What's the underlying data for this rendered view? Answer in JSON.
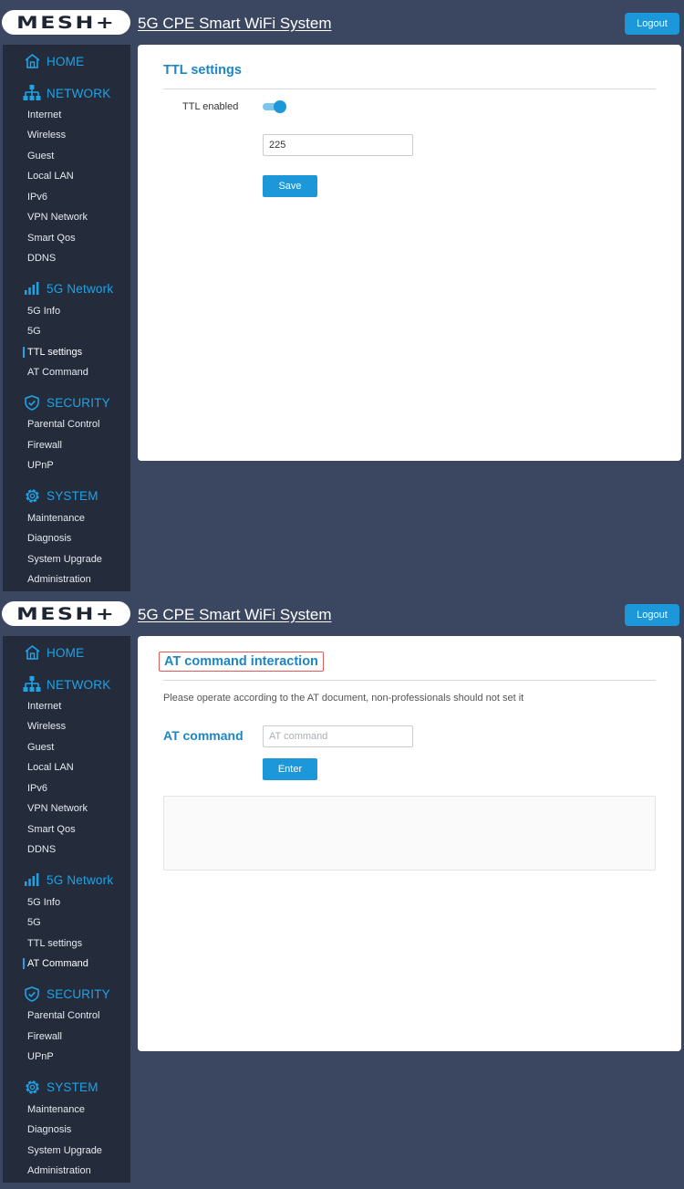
{
  "app": {
    "logo_text": "MESH+",
    "title": "5G CPE Smart WiFi System",
    "logout_label": "Logout"
  },
  "sidebar": {
    "home": {
      "label": "HOME",
      "icon": "home-icon"
    },
    "network": {
      "label": "NETWORK",
      "icon": "network-icon",
      "items": [
        "Internet",
        "Wireless",
        "Guest",
        "Local LAN",
        "IPv6",
        "VPN Network",
        "Smart Qos",
        "DDNS"
      ]
    },
    "fiveg": {
      "label": "5G Network",
      "icon": "signal-bars-icon",
      "items": [
        "5G Info",
        "5G",
        "TTL settings",
        "AT Command"
      ]
    },
    "security": {
      "label": "SECURITY",
      "icon": "shield-icon",
      "items": [
        "Parental Control",
        "Firewall",
        "UPnP"
      ]
    },
    "system": {
      "label": "SYSTEM",
      "icon": "gear-icon",
      "items": [
        "Maintenance",
        "Diagnosis",
        "System Upgrade",
        "Administration"
      ]
    }
  },
  "screens": [
    {
      "active_item": "TTL settings",
      "card_title": "TTL settings",
      "ttl_label": "TTL enabled",
      "ttl_enabled": true,
      "ttl_value": "225",
      "save_label": "Save"
    },
    {
      "active_item": "AT Command",
      "card_title": "AT command interaction",
      "note": "Please operate according to the AT document, non-professionals should not set it",
      "at_label": "AT command",
      "at_placeholder": "AT command",
      "at_value": "",
      "enter_label": "Enter"
    }
  ],
  "colors": {
    "background": "#3b4660",
    "sidebar": "#242c3c",
    "accent": "#1c97da",
    "highlight_box": "#e05a5a"
  }
}
